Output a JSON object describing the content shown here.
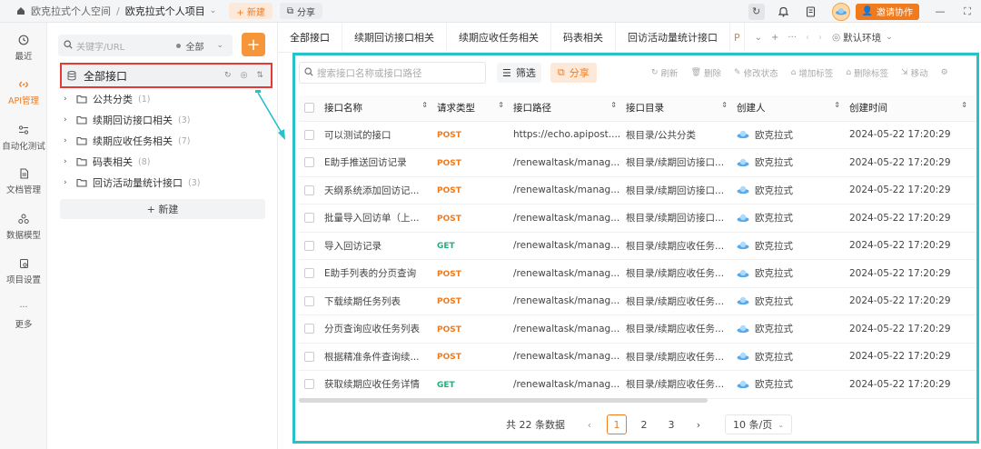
{
  "topbar": {
    "workspace": "欧克拉式个人空间",
    "separator": "/",
    "project": "欧克拉式个人项目",
    "new_label": "+ 新建",
    "share_label": "分享",
    "invite_label": "邀请协作"
  },
  "rail": {
    "items": [
      {
        "label": "最近",
        "icon": "clock-icon"
      },
      {
        "label": "API管理",
        "icon": "api-link-icon"
      },
      {
        "label": "自动化测试",
        "icon": "automation-icon"
      },
      {
        "label": "文档管理",
        "icon": "document-icon"
      },
      {
        "label": "数据模型",
        "icon": "data-model-icon"
      },
      {
        "label": "项目设置",
        "icon": "settings-icon"
      },
      {
        "label": "更多",
        "icon": "more-icon"
      }
    ]
  },
  "sidebar": {
    "search_placeholder": "关键字/URL",
    "scope": "全部",
    "all_label": "全部接口",
    "folders": [
      {
        "name": "公共分类",
        "count": "(1)"
      },
      {
        "name": "续期回访接口相关",
        "count": "(3)"
      },
      {
        "name": "续期应收任务相关",
        "count": "(7)"
      },
      {
        "name": "码表相关",
        "count": "(8)"
      },
      {
        "name": "回访活动量统计接口",
        "count": "(3)"
      }
    ],
    "new_label": "+ 新建"
  },
  "tabs": {
    "items": [
      "全部接口",
      "续期回访接口相关",
      "续期应收任务相关",
      "码表相关",
      "回访活动量统计接口"
    ],
    "partial": "P",
    "environment": "默认环境"
  },
  "toolbar": {
    "search_placeholder": "搜索接口名称或接口路径",
    "filter_label": "筛选",
    "share_label": "分享",
    "actions": [
      "刷新",
      "删除",
      "修改状态",
      "增加标签",
      "删除标签",
      "移动"
    ]
  },
  "table": {
    "columns": [
      "接口名称",
      "请求类型",
      "接口路径",
      "接口目录",
      "创建人",
      "创建时间"
    ],
    "rows": [
      {
        "name": "可以测试的接口",
        "method": "POST",
        "path": "https://echo.apipost....",
        "dir": "根目录/公共分类",
        "creator": "欧克拉式",
        "time": "2024-05-22 17:20:29"
      },
      {
        "name": "E助手推送回访记录",
        "method": "POST",
        "path": "/renewaltask/manag...",
        "dir": "根目录/续期回访接口...",
        "creator": "欧克拉式",
        "time": "2024-05-22 17:20:29"
      },
      {
        "name": "天纲系统添加回访记...",
        "method": "POST",
        "path": "/renewaltask/manag...",
        "dir": "根目录/续期回访接口...",
        "creator": "欧克拉式",
        "time": "2024-05-22 17:20:29"
      },
      {
        "name": "批量导入回访单（上...",
        "method": "POST",
        "path": "/renewaltask/manag...",
        "dir": "根目录/续期回访接口...",
        "creator": "欧克拉式",
        "time": "2024-05-22 17:20:29"
      },
      {
        "name": "导入回访记录",
        "method": "GET",
        "path": "/renewaltask/manag...",
        "dir": "根目录/续期应收任务...",
        "creator": "欧克拉式",
        "time": "2024-05-22 17:20:29"
      },
      {
        "name": "E助手列表的分页查询",
        "method": "POST",
        "path": "/renewaltask/manag...",
        "dir": "根目录/续期应收任务...",
        "creator": "欧克拉式",
        "time": "2024-05-22 17:20:29"
      },
      {
        "name": "下载续期任务列表",
        "method": "POST",
        "path": "/renewaltask/manag...",
        "dir": "根目录/续期应收任务...",
        "creator": "欧克拉式",
        "time": "2024-05-22 17:20:29"
      },
      {
        "name": "分页查询应收任务列表",
        "method": "POST",
        "path": "/renewaltask/manag...",
        "dir": "根目录/续期应收任务...",
        "creator": "欧克拉式",
        "time": "2024-05-22 17:20:29"
      },
      {
        "name": "根据精准条件查询续...",
        "method": "POST",
        "path": "/renewaltask/manag...",
        "dir": "根目录/续期应收任务...",
        "creator": "欧克拉式",
        "time": "2024-05-22 17:20:29"
      },
      {
        "name": "获取续期应收任务详情",
        "method": "GET",
        "path": "/renewaltask/manag...",
        "dir": "根目录/续期应收任务...",
        "creator": "欧克拉式",
        "time": "2024-05-22 17:20:29"
      }
    ]
  },
  "pager": {
    "total": "共 22 条数据",
    "pages": [
      "1",
      "2",
      "3"
    ],
    "current": "1",
    "size": "10 条/页"
  },
  "colors": {
    "accent": "#f07b1e",
    "highlight_box": "#27c1c9",
    "selection_box": "#e53935",
    "get": "#21b07b"
  }
}
